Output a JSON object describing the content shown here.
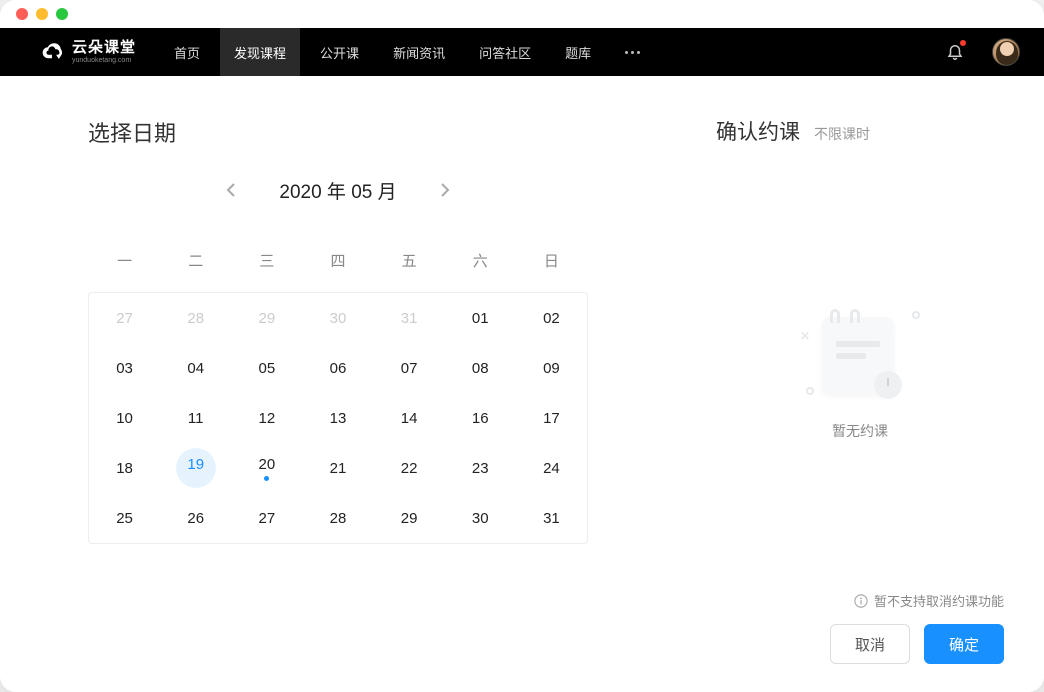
{
  "brand": {
    "name": "云朵课堂",
    "domain": "yunduoketang.com"
  },
  "nav": {
    "items": [
      {
        "label": "首页",
        "active": false
      },
      {
        "label": "发现课程",
        "active": true
      },
      {
        "label": "公开课",
        "active": false
      },
      {
        "label": "新闻资讯",
        "active": false
      },
      {
        "label": "问答社区",
        "active": false
      },
      {
        "label": "题库",
        "active": false
      }
    ],
    "has_more": true,
    "has_notification": true
  },
  "left": {
    "title": "选择日期",
    "calendar": {
      "year": 2020,
      "month": 5,
      "month_label": "2020 年 05 月",
      "weekdays": [
        "一",
        "二",
        "三",
        "四",
        "五",
        "六",
        "日"
      ],
      "cells": [
        {
          "d": "27",
          "other": true
        },
        {
          "d": "28",
          "other": true
        },
        {
          "d": "29",
          "other": true
        },
        {
          "d": "30",
          "other": true
        },
        {
          "d": "31",
          "other": true
        },
        {
          "d": "01"
        },
        {
          "d": "02"
        },
        {
          "d": "03"
        },
        {
          "d": "04"
        },
        {
          "d": "05"
        },
        {
          "d": "06"
        },
        {
          "d": "07"
        },
        {
          "d": "08"
        },
        {
          "d": "09"
        },
        {
          "d": "10"
        },
        {
          "d": "11"
        },
        {
          "d": "12"
        },
        {
          "d": "13"
        },
        {
          "d": "14"
        },
        {
          "d": "16"
        },
        {
          "d": "17"
        },
        {
          "d": "18"
        },
        {
          "d": "19",
          "today": true,
          "dot": true
        },
        {
          "d": "20",
          "dot": true
        },
        {
          "d": "21"
        },
        {
          "d": "22"
        },
        {
          "d": "23"
        },
        {
          "d": "24"
        },
        {
          "d": "25"
        },
        {
          "d": "26"
        },
        {
          "d": "27"
        },
        {
          "d": "28"
        },
        {
          "d": "29"
        },
        {
          "d": "30"
        },
        {
          "d": "31"
        }
      ]
    }
  },
  "right": {
    "title": "确认约课",
    "subtitle": "不限课时",
    "empty_text": "暂无约课",
    "note": "暂不支持取消约课功能",
    "cancel_label": "取消",
    "confirm_label": "确定"
  }
}
